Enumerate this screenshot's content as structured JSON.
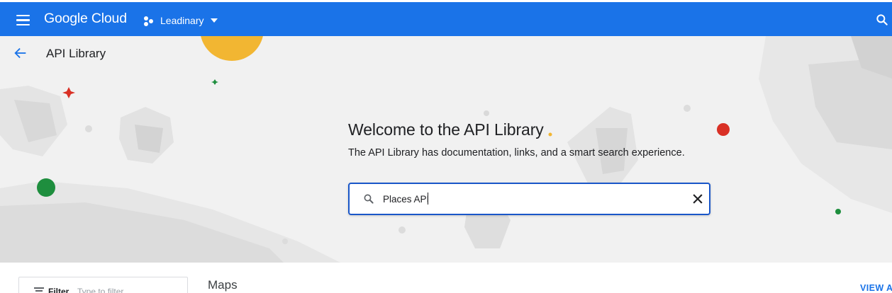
{
  "topbar": {
    "brand": "Google Cloud",
    "project": "Leadinary",
    "icons": [
      "menu-icon",
      "project-icon",
      "chevron-down-icon",
      "search-icon"
    ]
  },
  "header": {
    "title": "API Library",
    "back_icon": "arrow-back-icon"
  },
  "hero": {
    "title": "Welcome to the API Library",
    "subtitle": "The API Library has documentation, links, and a smart search experience.",
    "search": {
      "value": "Places API",
      "icon": "search-icon",
      "clear_icon": "close-icon"
    }
  },
  "filter": {
    "label": "Filter",
    "placeholder": "Type to filter",
    "icon": "filter-icon"
  },
  "section": {
    "title": "Maps",
    "view_all": "VIEW AI"
  },
  "colors": {
    "topbar": "#1a73e8",
    "hero_bg": "#f1f1f1",
    "search_border": "#1a57c9",
    "accent_yellow": "#f2b632",
    "accent_red": "#d93025",
    "accent_green": "#1e8e3e"
  }
}
